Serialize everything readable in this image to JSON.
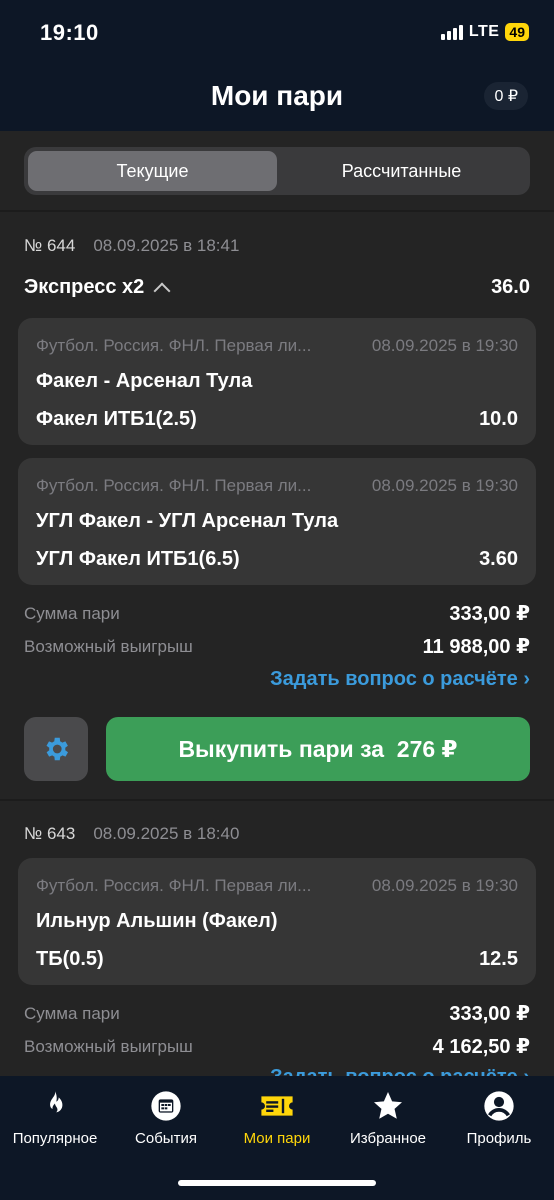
{
  "status": {
    "time": "19:10",
    "network": "LTE",
    "battery": "49"
  },
  "header": {
    "title": "Мои пари",
    "balance": "0 ₽"
  },
  "tabs": [
    {
      "label": "Текущие",
      "active": true
    },
    {
      "label": "Рассчитанные",
      "active": false
    }
  ],
  "bets": [
    {
      "number": "№ 644",
      "date": "08.09.2025 в 18:41",
      "type": "Экспресс x2",
      "total_odds": "36.0",
      "events": [
        {
          "league": "Футбол. Россия. ФНЛ. Первая ли...",
          "time": "08.09.2025 в 19:30",
          "teams": "Факел - Арсенал Тула",
          "market": "Факел ИТБ1(2.5)",
          "odds": "10.0"
        },
        {
          "league": "Футбол. Россия. ФНЛ. Первая ли...",
          "time": "08.09.2025 в 19:30",
          "teams": "УГЛ Факел - УГЛ Арсенал Тула",
          "market": "УГЛ Факел ИТБ1(6.5)",
          "odds": "3.60"
        }
      ],
      "stake_label": "Сумма пари",
      "stake": "333,00 ₽",
      "win_label": "Возможный выигрыш",
      "win": "11 988,00 ₽",
      "question": "Задать вопрос о расчёте ›",
      "cashout": "Выкупить пари за  276 ₽"
    },
    {
      "number": "№ 643",
      "date": "08.09.2025 в 18:40",
      "events": [
        {
          "league": "Футбол. Россия. ФНЛ. Первая ли...",
          "time": "08.09.2025 в 19:30",
          "teams": "Ильнур Альшин (Факел)",
          "market": "ТБ(0.5)",
          "odds": "12.5"
        }
      ],
      "stake_label": "Сумма пари",
      "stake": "333,00 ₽",
      "win_label": "Возможный выигрыш",
      "win": "4 162,50 ₽",
      "question": "Задать вопрос о расчёте ›"
    }
  ],
  "nav": [
    {
      "label": "Популярное",
      "icon": "flame-icon"
    },
    {
      "label": "События",
      "icon": "calendar-icon"
    },
    {
      "label": "Мои пари",
      "icon": "ticket-icon",
      "active": true
    },
    {
      "label": "Избранное",
      "icon": "star-icon"
    },
    {
      "label": "Профиль",
      "icon": "profile-icon"
    }
  ],
  "colors": {
    "accent": "#ffd60a",
    "link": "#3b9bdc",
    "cashout": "#3c9e58",
    "header_bg": "#0d1726"
  }
}
